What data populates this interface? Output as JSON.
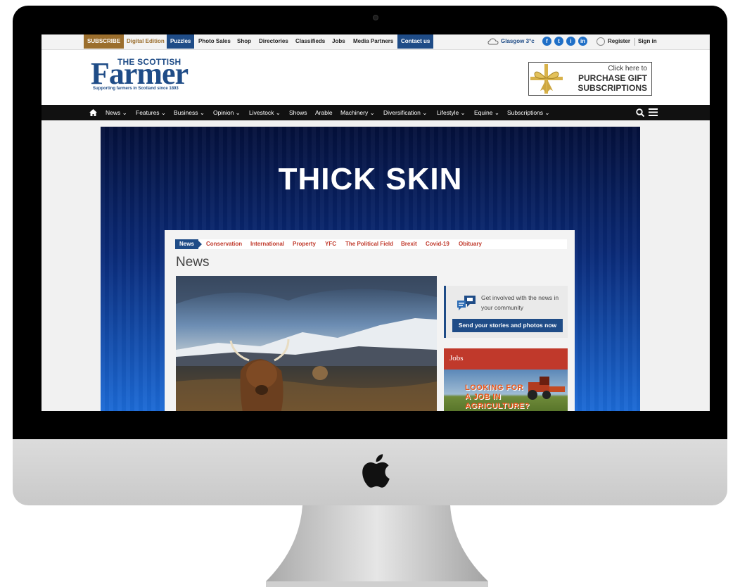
{
  "topbar": {
    "subscribe": "SUBSCRIBE",
    "digital_edition": "Digital Edition",
    "puzzles": "Puzzles",
    "photo_sales": "Photo Sales",
    "shop": "Shop",
    "directories": "Directories",
    "classifieds": "Classifieds",
    "jobs": "Jobs",
    "media_partners": "Media Partners",
    "contact_us": "Contact us",
    "weather": "Glasgow 3°c",
    "social": [
      "f",
      "t",
      "i",
      "in"
    ],
    "register": "Register",
    "sign_in": "Sign in"
  },
  "header": {
    "logo_the": "THE SCOTTISH",
    "logo_name": "Farmer",
    "logo_tagline": "Supporting farmers in Scotland since 1893",
    "ad_line1": "Click here to",
    "ad_line2": "PURCHASE GIFT",
    "ad_line3": "SUBSCRIPTIONS"
  },
  "nav": {
    "items": [
      "News",
      "Features",
      "Business",
      "Opinion",
      "Livestock",
      "Shows",
      "Arable",
      "Machinery",
      "Diversification",
      "Lifestyle",
      "Equine",
      "Subscriptions"
    ]
  },
  "hero": {
    "title": "THICK SKIN"
  },
  "card": {
    "subnav_active": "News",
    "subnav": [
      "Conservation",
      "International",
      "Property",
      "YFC",
      "The Political Field",
      "Brexit",
      "Covid-19",
      "Obituary"
    ],
    "title": "News"
  },
  "community": {
    "text": "Get involved with the news in your community",
    "button": "Send your stories and photos now"
  },
  "jobs": {
    "title": "Jobs",
    "ad_lines": [
      "LOOKING FOR",
      "A JOB IN",
      "AGRICULTURE?"
    ]
  },
  "colors": {
    "brand_blue": "#1f4c87",
    "accent_red": "#c0392b",
    "subscribe_gold": "#9b6e2d",
    "nav_black": "#111111"
  }
}
